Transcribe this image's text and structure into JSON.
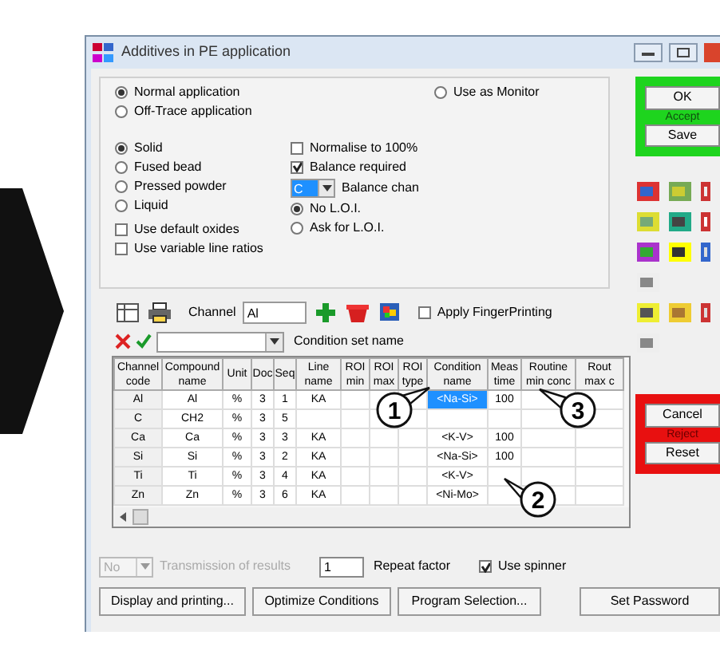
{
  "window": {
    "title": "Additives in PE application"
  },
  "application_modes": [
    {
      "label": "Normal application",
      "selected": true
    },
    {
      "label": "Off-Trace application",
      "selected": false
    },
    {
      "label": "Use as Monitor",
      "selected": false
    }
  ],
  "sample_types": [
    {
      "label": "Solid",
      "selected": true
    },
    {
      "label": "Fused bead",
      "selected": false
    },
    {
      "label": "Pressed powder",
      "selected": false
    },
    {
      "label": "Liquid",
      "selected": false
    }
  ],
  "normalise": {
    "label": "Normalise to 100%",
    "checked": false
  },
  "balance_required": {
    "label": "Balance required",
    "checked": true
  },
  "balance_channel": {
    "value": "C",
    "label": "Balance chan"
  },
  "loi_options": [
    {
      "label": "No L.O.I.",
      "selected": true
    },
    {
      "label": "Ask for L.O.I.",
      "selected": false
    }
  ],
  "options": [
    {
      "label": "Use default oxides",
      "checked": false
    },
    {
      "label": "Use variable line ratios",
      "checked": false
    }
  ],
  "channel": {
    "label": "Channel",
    "value": "Al"
  },
  "fingerprinting": {
    "label": "Apply FingerPrinting",
    "checked": false
  },
  "condition_set": {
    "label": "Condition set name"
  },
  "table": {
    "columns": [
      "Channel code",
      "Compound name",
      "Unit",
      "Doc",
      "Seq",
      "Line name",
      "ROI min",
      "ROI max",
      "ROI type",
      "Condition name",
      "Meas time",
      "Routine min conc",
      "Rout max c"
    ],
    "rows": [
      {
        "code": "Al",
        "compound": "Al",
        "unit": "%",
        "doc": "3",
        "seq": "1",
        "line": "KA",
        "condition": "<Na-Si>",
        "condition_selected": true,
        "time": "100"
      },
      {
        "code": "C",
        "compound": "CH2",
        "unit": "%",
        "doc": "3",
        "seq": "5",
        "condition_selected": false
      },
      {
        "code": "Ca",
        "compound": "Ca",
        "unit": "%",
        "doc": "3",
        "seq": "3",
        "line": "KA",
        "condition": "<K-V>",
        "condition_selected": false,
        "time": "100"
      },
      {
        "code": "Si",
        "compound": "Si",
        "unit": "%",
        "doc": "3",
        "seq": "2",
        "line": "KA",
        "condition": "<Na-Si>",
        "condition_selected": false,
        "time": "100"
      },
      {
        "code": "Ti",
        "compound": "Ti",
        "unit": "%",
        "doc": "3",
        "seq": "4",
        "line": "KA",
        "condition": "<K-V>",
        "condition_selected": false
      },
      {
        "code": "Zn",
        "compound": "Zn",
        "unit": "%",
        "doc": "3",
        "seq": "6",
        "line": "KA",
        "condition": "<Ni-Mo>",
        "condition_selected": false
      }
    ]
  },
  "callouts": [
    {
      "label": "1"
    },
    {
      "label": "2"
    },
    {
      "label": "3"
    }
  ],
  "accept": {
    "buttons": [
      "OK",
      "Save"
    ],
    "label": "Accept"
  },
  "reject": {
    "buttons": [
      "Cancel",
      "Reset"
    ],
    "label": "Reject"
  },
  "transmission": {
    "value": "No",
    "label": "Transmission of results",
    "disabled": true
  },
  "repeat": {
    "value": "1",
    "label": "Repeat factor"
  },
  "spinner": {
    "label": "Use spinner",
    "checked": true
  },
  "buttons": [
    "Display and printing...",
    "Optimize Conditions",
    "Program Selection...",
    "Set Password"
  ]
}
